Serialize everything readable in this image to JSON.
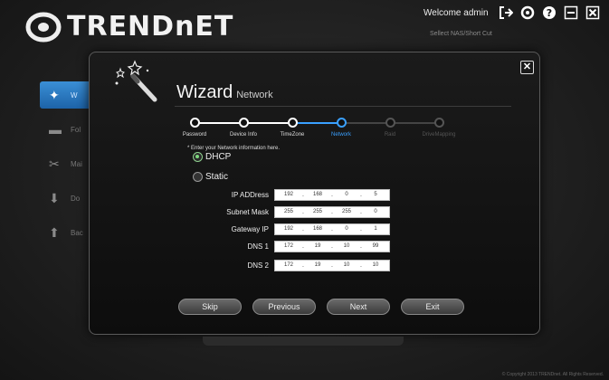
{
  "header": {
    "logo_text": "TRENDnET",
    "welcome": "Welcome admin",
    "subnav": "Sellect NAS/Short Cut",
    "icons": [
      "logout-icon",
      "settings-icon",
      "help-icon",
      "minimize-icon",
      "close-icon"
    ]
  },
  "bg_menu": {
    "items": [
      {
        "label": "W",
        "icon": "wand-icon"
      },
      {
        "label": "Fol",
        "icon": "folder-icon"
      },
      {
        "label": "Mai",
        "icon": "tools-icon"
      },
      {
        "label": "Do",
        "icon": "download-icon"
      },
      {
        "label": "Bac",
        "icon": "backup-icon"
      }
    ]
  },
  "wizard": {
    "title": "Wizard",
    "subtitle": "Network",
    "steps": [
      {
        "label": "Password",
        "state": "done"
      },
      {
        "label": "Device Info",
        "state": "done"
      },
      {
        "label": "TimeZone",
        "state": "done"
      },
      {
        "label": "Network",
        "state": "current"
      },
      {
        "label": "Raid",
        "state": "todo"
      },
      {
        "label": "DriveMapping",
        "state": "todo"
      }
    ],
    "hint": "* Enter your Network information here.",
    "dhcp_label": "DHCP",
    "static_label": "Static",
    "fields": [
      {
        "label": "IP ADDress",
        "octets": [
          "192",
          "168",
          "0",
          "5"
        ]
      },
      {
        "label": "Subnet Mask",
        "octets": [
          "255",
          "255",
          "255",
          "0"
        ]
      },
      {
        "label": "Gateway IP",
        "octets": [
          "192",
          "168",
          "0",
          "1"
        ]
      },
      {
        "label": "DNS 1",
        "octets": [
          "172",
          "19",
          "10",
          "99"
        ]
      },
      {
        "label": "DNS 2",
        "octets": [
          "172",
          "19",
          "10",
          "10"
        ]
      }
    ],
    "buttons": {
      "skip": "Skip",
      "previous": "Previous",
      "next": "Next",
      "exit": "Exit"
    }
  },
  "copyright": "© Copyright 2013 TRENDnet. All Rights Reserved."
}
